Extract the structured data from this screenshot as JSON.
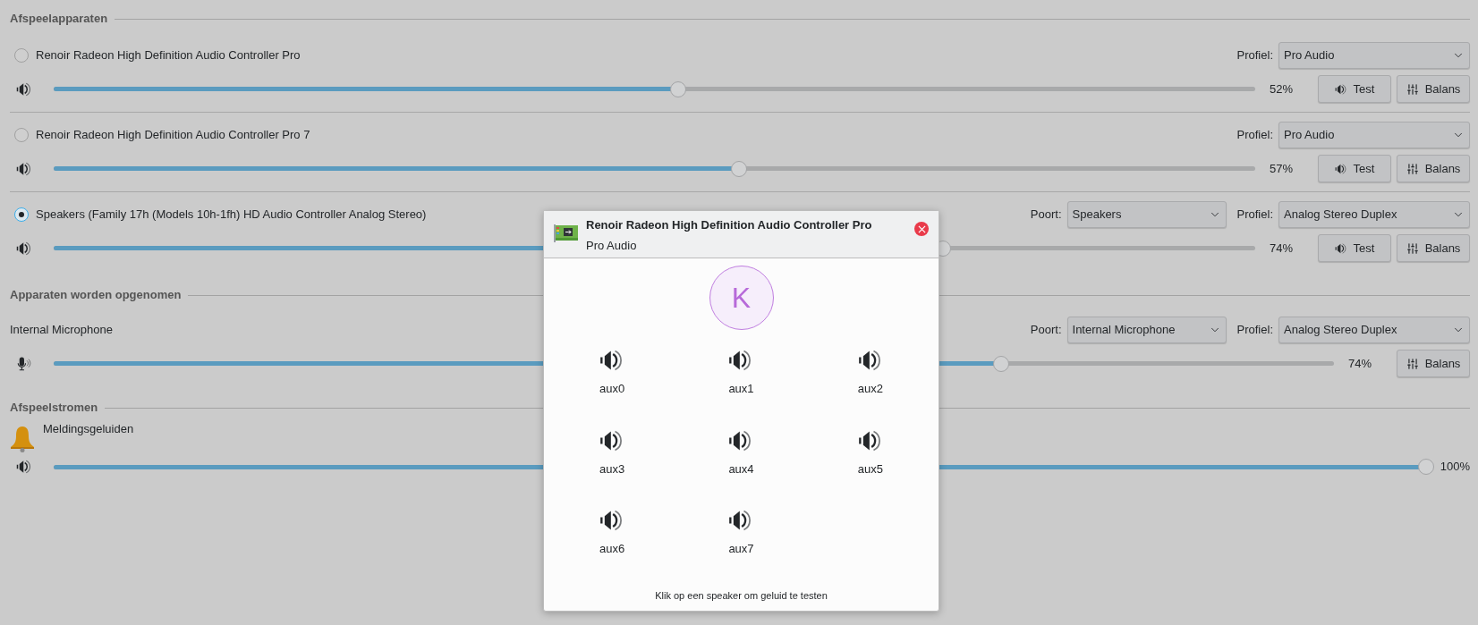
{
  "playback_devices": {
    "title": "Afspeelapparaten",
    "items": [
      {
        "name": "Renoir Radeon High Definition Audio Controller Pro",
        "selected": false,
        "profile_label": "Profiel:",
        "profile": "Pro Audio",
        "level": 0.52,
        "reading": "52%",
        "test_label": "Test",
        "balance_label": "Balans"
      },
      {
        "name": "Renoir Radeon High Definition Audio Controller Pro 7",
        "selected": false,
        "profile_label": "Profiel:",
        "profile": "Pro Audio",
        "level": 0.57,
        "reading": "57%",
        "test_label": "Test",
        "balance_label": "Balans"
      },
      {
        "name": "Speakers (Family 17h (Models 10h-1fh) HD Audio Controller Analog Stereo)",
        "selected": true,
        "port_label": "Poort:",
        "port": "Speakers",
        "profile_label": "Profiel:",
        "profile": "Analog Stereo Duplex",
        "level": 0.74,
        "reading": "74%",
        "test_label": "Test",
        "balance_label": "Balans"
      }
    ]
  },
  "recording_devices": {
    "title": "Apparaten worden opgenomen",
    "items": [
      {
        "name": "Internal Microphone",
        "port_label": "Poort:",
        "port": "Internal Microphone",
        "profile_label": "Profiel:",
        "profile": "Analog Stereo Duplex",
        "level": 0.74,
        "reading": "74%",
        "balance_label": "Balans"
      }
    ]
  },
  "playback_streams": {
    "title": "Afspeelstromen",
    "items": [
      {
        "name": "Meldingsgeluiden",
        "level": 1,
        "reading": "100%"
      }
    ]
  },
  "dialog": {
    "title": "Renoir Radeon High Definition Audio Controller Pro",
    "subtitle": "Pro Audio",
    "avatar_letter": "K",
    "speakers": [
      {
        "label": "aux0"
      },
      {
        "label": "aux1"
      },
      {
        "label": "aux2"
      },
      {
        "label": "aux3"
      },
      {
        "label": "aux4"
      },
      {
        "label": "aux5"
      },
      {
        "label": "aux6"
      },
      {
        "label": "aux7"
      }
    ],
    "hint": "Klik op een speaker om geluid te testen"
  }
}
